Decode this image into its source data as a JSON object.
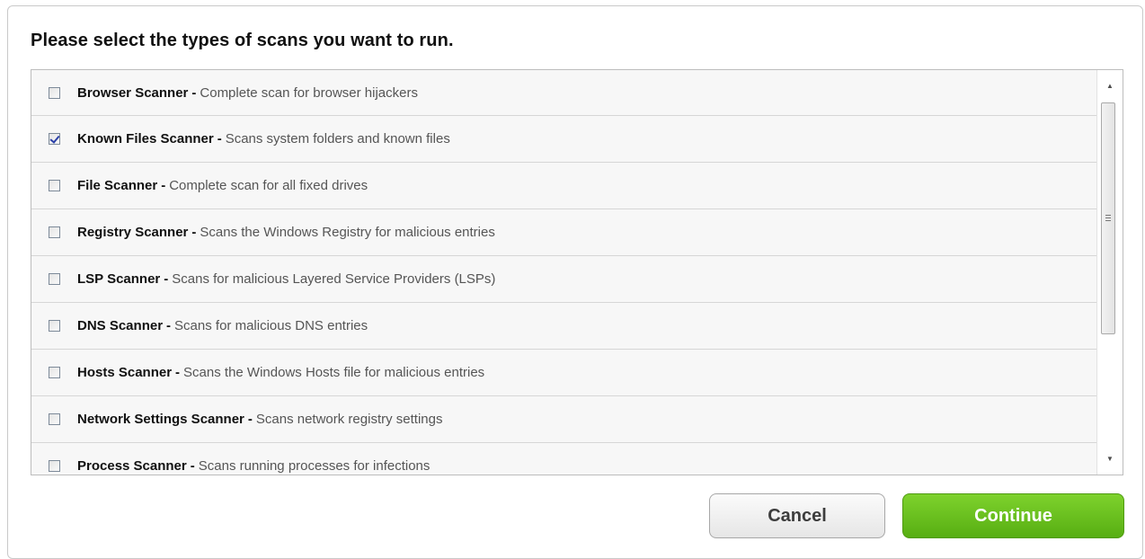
{
  "dialog": {
    "heading": "Please select the types of scans you want to run."
  },
  "scan_list": [
    {
      "name": "Browser Scanner",
      "separator": "-",
      "description": "Complete scan for browser hijackers",
      "checked": false
    },
    {
      "name": "Known Files Scanner",
      "separator": "-",
      "description": "Scans system folders and known files",
      "checked": true
    },
    {
      "name": "File Scanner",
      "separator": "-",
      "description": "Complete scan for all fixed drives",
      "checked": false
    },
    {
      "name": "Registry Scanner",
      "separator": "-",
      "description": "Scans the Windows Registry for malicious entries",
      "checked": false
    },
    {
      "name": "LSP Scanner",
      "separator": "-",
      "description": "Scans for malicious Layered Service Providers (LSPs)",
      "checked": false
    },
    {
      "name": "DNS Scanner",
      "separator": "-",
      "description": "Scans for malicious DNS entries",
      "checked": false
    },
    {
      "name": "Hosts Scanner",
      "separator": "-",
      "description": "Scans the Windows Hosts file for malicious entries",
      "checked": false
    },
    {
      "name": "Network Settings Scanner",
      "separator": "-",
      "description": "Scans network registry settings",
      "checked": false
    },
    {
      "name": "Process Scanner",
      "separator": "-",
      "description": "Scans running processes for infections",
      "checked": false
    }
  ],
  "scrollbar": {
    "up_glyph": "▲",
    "down_glyph": "▼"
  },
  "buttons": {
    "cancel_label": "Cancel",
    "continue_label": "Continue"
  },
  "colors": {
    "continue_green": "#6cc01f",
    "checkmark_blue": "#2a3fa8"
  }
}
